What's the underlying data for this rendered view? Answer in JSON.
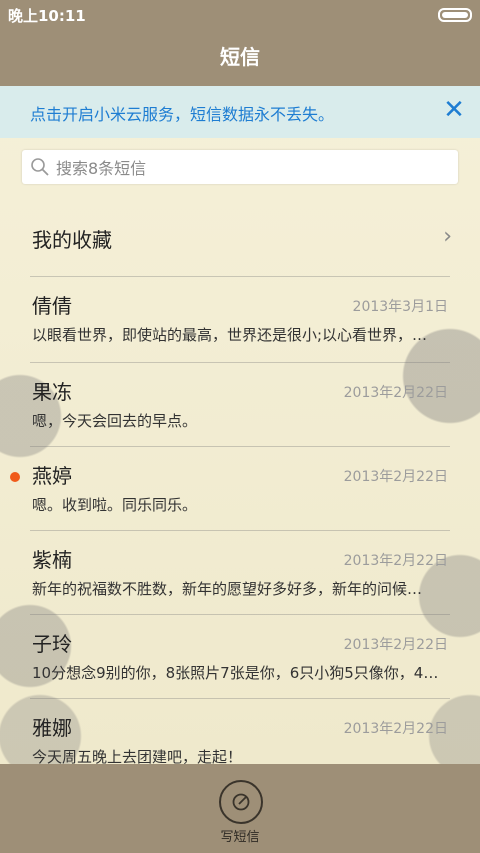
{
  "status": {
    "time": "晚上10:11"
  },
  "header": {
    "title": "短信"
  },
  "banner": {
    "text": "点击开启小米云服务，短信数据永不丢失。"
  },
  "search": {
    "placeholder": "搜索8条短信",
    "value": ""
  },
  "favorites": {
    "label": "我的收藏"
  },
  "messages": [
    {
      "name": "倩倩",
      "date": "2013年3月1日",
      "preview": "以眼看世界，即使站的最高，世界还是很小;以心看世界，…",
      "unread": false
    },
    {
      "name": "果冻",
      "date": "2013年2月22日",
      "preview": "嗯，今天会回去的早点。",
      "unread": false
    },
    {
      "name": "燕婷",
      "date": "2013年2月22日",
      "preview": "嗯。收到啦。同乐同乐。",
      "unread": true
    },
    {
      "name": "紫楠",
      "date": "2013年2月22日",
      "preview": "新年的祝福数不胜数，新年的愿望好多好多，新年的问候…",
      "unread": false
    },
    {
      "name": "子玲",
      "date": "2013年2月22日",
      "preview": "10分想念9别的你，8张照片7张是你，6只小狗5只像你，4…",
      "unread": false
    },
    {
      "name": "雅娜",
      "date": "2013年2月22日",
      "preview": "今天周五晚上去团建吧，走起！",
      "unread": false
    }
  ],
  "bottom": {
    "compose_label": "写短信"
  },
  "colors": {
    "bar": "#9e8f77",
    "accent": "#1e7dd2",
    "unread": "#f05a1a",
    "background": "#f5f0d8"
  },
  "icons": {
    "banner_close": "close-icon",
    "search": "search-icon",
    "chevron": "chevron-right-icon",
    "compose": "compose-icon"
  }
}
